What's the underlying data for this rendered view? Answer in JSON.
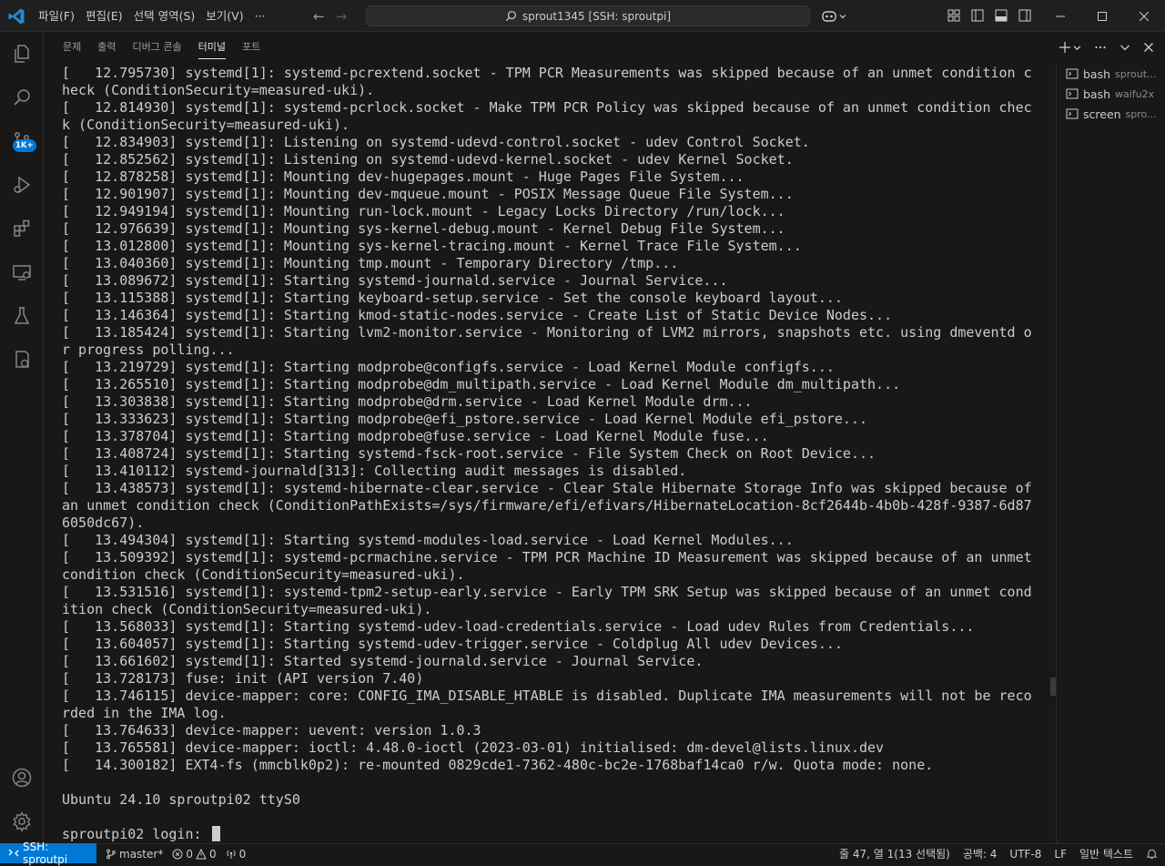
{
  "titlebar": {
    "menus": [
      "파일(F)",
      "편집(E)",
      "선택 영역(S)",
      "보기(V)",
      "···"
    ],
    "command_center": "sprout1345 [SSH: sproutpi]"
  },
  "activity_bar": {
    "icons": [
      "explorer-icon",
      "search-icon",
      "source-control-icon",
      "run-debug-icon",
      "extensions-icon",
      "remote-explorer-icon",
      "testing-icon",
      "remote-status-icon",
      "account-icon",
      "settings-gear-icon"
    ],
    "source_control_badge": "1K+"
  },
  "panel": {
    "tabs": [
      {
        "label": "문제",
        "active": false
      },
      {
        "label": "출력",
        "active": false
      },
      {
        "label": "디버그 콘솔",
        "active": false
      },
      {
        "label": "터미널",
        "active": true
      },
      {
        "label": "포트",
        "active": false
      }
    ],
    "actions": [
      "add-terminal-icon",
      "chevron-down-icon",
      "more-icon",
      "collapse-icon",
      "close-icon"
    ]
  },
  "terminal": {
    "lines": [
      "[   12.795730] systemd[1]: systemd-pcrextend.socket - TPM PCR Measurements was skipped because of an unmet condition check (ConditionSecurity=measured-uki).",
      "[   12.814930] systemd[1]: systemd-pcrlock.socket - Make TPM PCR Policy was skipped because of an unmet condition check (ConditionSecurity=measured-uki).",
      "[   12.834903] systemd[1]: Listening on systemd-udevd-control.socket - udev Control Socket.",
      "[   12.852562] systemd[1]: Listening on systemd-udevd-kernel.socket - udev Kernel Socket.",
      "[   12.878258] systemd[1]: Mounting dev-hugepages.mount - Huge Pages File System...",
      "[   12.901907] systemd[1]: Mounting dev-mqueue.mount - POSIX Message Queue File System...",
      "[   12.949194] systemd[1]: Mounting run-lock.mount - Legacy Locks Directory /run/lock...",
      "[   12.976639] systemd[1]: Mounting sys-kernel-debug.mount - Kernel Debug File System...",
      "[   13.012800] systemd[1]: Mounting sys-kernel-tracing.mount - Kernel Trace File System...",
      "[   13.040360] systemd[1]: Mounting tmp.mount - Temporary Directory /tmp...",
      "[   13.089672] systemd[1]: Starting systemd-journald.service - Journal Service...",
      "[   13.115388] systemd[1]: Starting keyboard-setup.service - Set the console keyboard layout...",
      "[   13.146364] systemd[1]: Starting kmod-static-nodes.service - Create List of Static Device Nodes...",
      "[   13.185424] systemd[1]: Starting lvm2-monitor.service - Monitoring of LVM2 mirrors, snapshots etc. using dmeventd or progress polling...",
      "[   13.219729] systemd[1]: Starting modprobe@configfs.service - Load Kernel Module configfs...",
      "[   13.265510] systemd[1]: Starting modprobe@dm_multipath.service - Load Kernel Module dm_multipath...",
      "[   13.303838] systemd[1]: Starting modprobe@drm.service - Load Kernel Module drm...",
      "[   13.333623] systemd[1]: Starting modprobe@efi_pstore.service - Load Kernel Module efi_pstore...",
      "[   13.378704] systemd[1]: Starting modprobe@fuse.service - Load Kernel Module fuse...",
      "[   13.408724] systemd[1]: Starting systemd-fsck-root.service - File System Check on Root Device...",
      "[   13.410112] systemd-journald[313]: Collecting audit messages is disabled.",
      "[   13.438573] systemd[1]: systemd-hibernate-clear.service - Clear Stale Hibernate Storage Info was skipped because of an unmet condition check (ConditionPathExists=/sys/firmware/efi/efivars/HibernateLocation-8cf2644b-4b0b-428f-9387-6d876050dc67).",
      "[   13.494304] systemd[1]: Starting systemd-modules-load.service - Load Kernel Modules...",
      "[   13.509392] systemd[1]: systemd-pcrmachine.service - TPM PCR Machine ID Measurement was skipped because of an unmet condition check (ConditionSecurity=measured-uki).",
      "[   13.531516] systemd[1]: systemd-tpm2-setup-early.service - Early TPM SRK Setup was skipped because of an unmet condition check (ConditionSecurity=measured-uki).",
      "[   13.568033] systemd[1]: Starting systemd-udev-load-credentials.service - Load udev Rules from Credentials...",
      "[   13.604057] systemd[1]: Starting systemd-udev-trigger.service - Coldplug All udev Devices...",
      "[   13.661602] systemd[1]: Started systemd-journald.service - Journal Service.",
      "[   13.728173] fuse: init (API version 7.40)",
      "[   13.746115] device-mapper: core: CONFIG_IMA_DISABLE_HTABLE is disabled. Duplicate IMA measurements will not be recorded in the IMA log.",
      "[   13.764633] device-mapper: uevent: version 1.0.3",
      "[   13.765581] device-mapper: ioctl: 4.48.0-ioctl (2023-03-01) initialised: dm-devel@lists.linux.dev",
      "[   14.300182] EXT4-fs (mmcblk0p2): re-mounted 0829cde1-7362-480c-bc2e-1768baf14ca0 r/w. Quota mode: none.",
      "",
      "Ubuntu 24.10 sproutpi02 ttyS0",
      ""
    ],
    "prompt": "sproutpi02 login: "
  },
  "terminal_list": [
    {
      "name": "bash",
      "desc": "sprout..."
    },
    {
      "name": "bash",
      "desc": "waifu2x"
    },
    {
      "name": "screen",
      "desc": "spro..."
    }
  ],
  "statusbar": {
    "remote": "SSH: sproutpi",
    "branch": "master*",
    "errors": "0",
    "warnings": "0",
    "ports": "0",
    "position": "줄 47, 열 1(13 선택됨)",
    "spaces": "공백: 4",
    "encoding": "UTF-8",
    "eol": "LF",
    "language": "일반 텍스트"
  }
}
